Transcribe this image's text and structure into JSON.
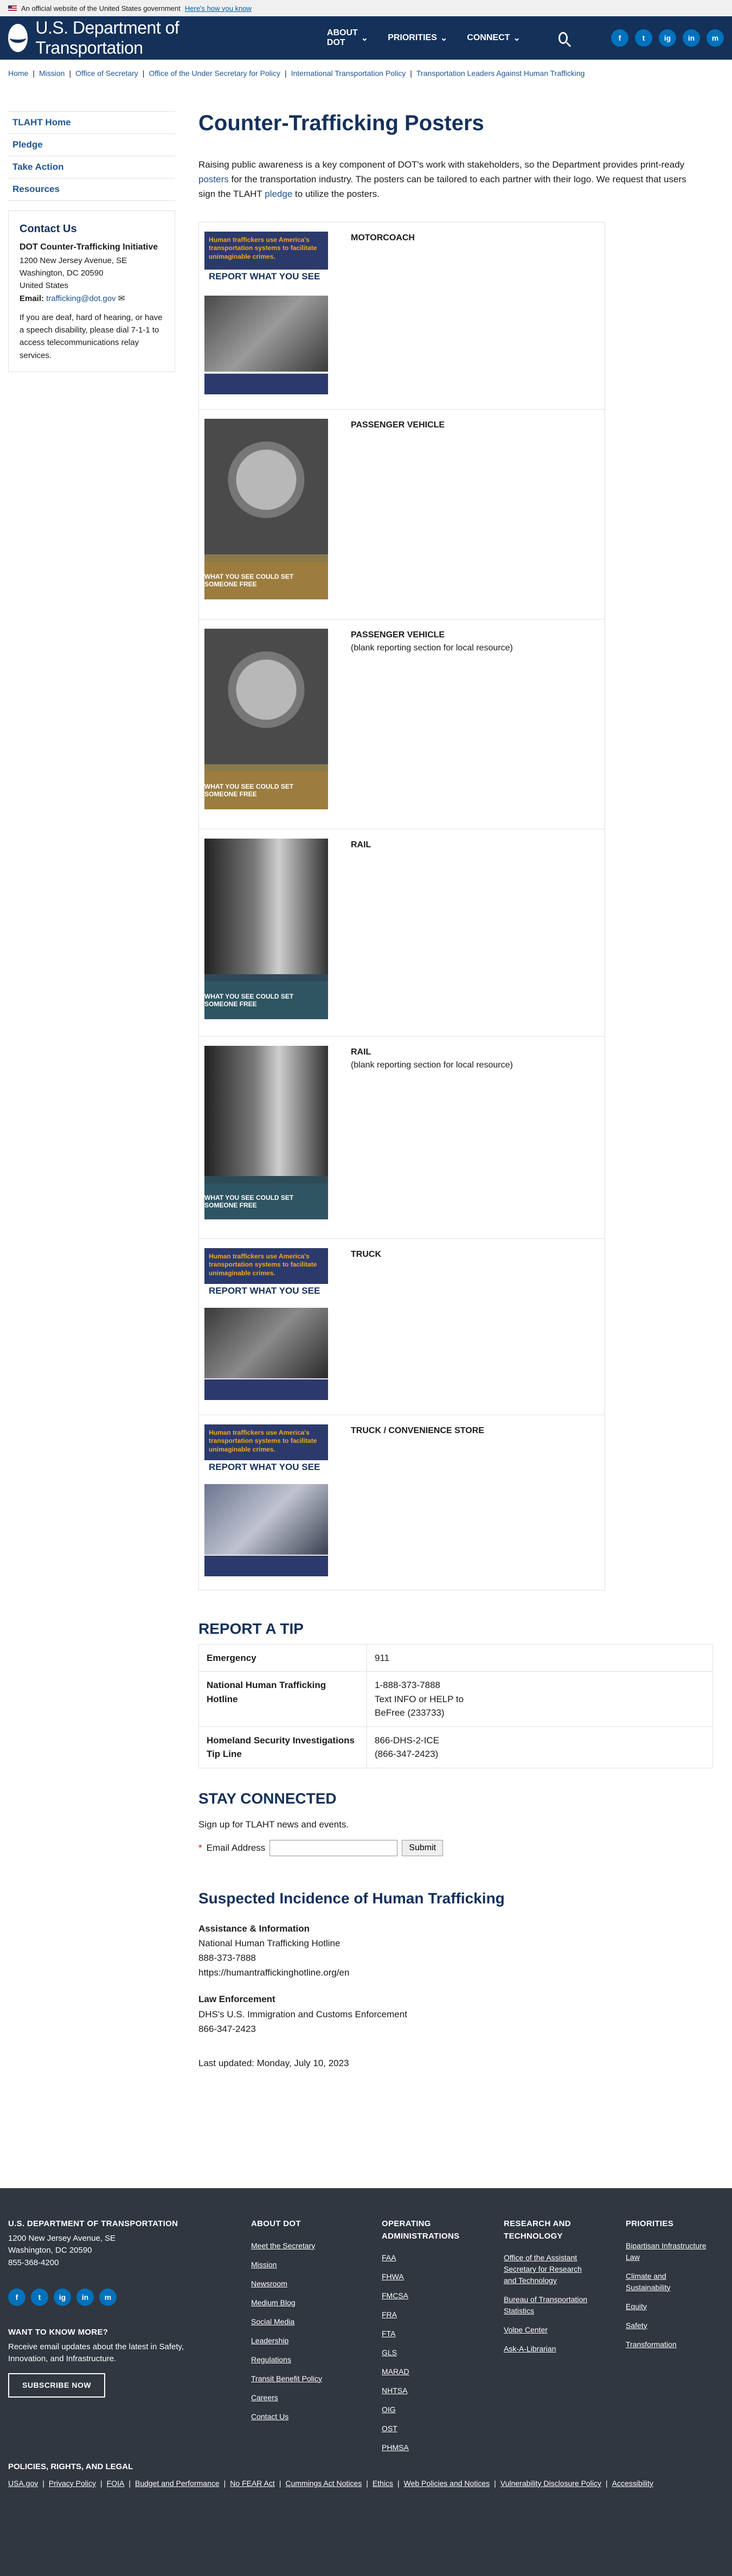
{
  "banner": {
    "text": "An official website of the United States government",
    "link": "Here's how you know"
  },
  "header": {
    "site_name": "U.S. Department of Transportation",
    "nav": [
      "ABOUT DOT",
      "PRIORITIES",
      "CONNECT"
    ],
    "social": [
      "f",
      "t",
      "ig",
      "in",
      "m"
    ]
  },
  "breadcrumb": [
    "Home",
    "Mission",
    "Office of Secretary",
    "Office of the Under Secretary for Policy",
    "International Transportation Policy",
    "Transportation Leaders Against Human Trafficking"
  ],
  "sidebar": {
    "nav": [
      "TLAHT Home",
      "Pledge",
      "Take Action",
      "Resources"
    ],
    "contact": {
      "title": "Contact Us",
      "name": "DOT Counter-Trafficking Initiative",
      "addr1": "1200 New Jersey Avenue, SE",
      "addr2": "Washington, DC 20590",
      "country": "United States",
      "email_label": "Email:",
      "email": "trafficking@dot.gov",
      "note": "If you are deaf, hard of hearing, or have a speech disability, please dial 7-1-1 to access telecommunications relay services."
    }
  },
  "main": {
    "title": "Counter-Trafficking Posters",
    "intro_1": "Raising public awareness is a key component of DOT's work with stakeholders, so the Department provides print-ready",
    "intro_link1": "posters",
    "intro_2": "for the transportation industry.  The posters can be tailored to each partner with their logo.  We request that users sign the TLAHT",
    "intro_link2": "pledge",
    "intro_3": "to utilize the posters."
  },
  "posters": [
    {
      "label": "MOTORCOACH",
      "sub": ""
    },
    {
      "label": "PASSENGER VEHICLE",
      "sub": ""
    },
    {
      "label": "PASSENGER VEHICLE",
      "sub": "(blank reporting section for local resource)"
    },
    {
      "label": "RAIL",
      "sub": ""
    },
    {
      "label": "RAIL",
      "sub": "(blank reporting section for local resource)"
    },
    {
      "label": "TRUCK",
      "sub": ""
    },
    {
      "label": "TRUCK / CONVENIENCE STORE",
      "sub": ""
    }
  ],
  "poster_text": {
    "headline": "Human traffickers use America's transportation systems to facilitate unimaginable crimes.",
    "report": "REPORT WHAT YOU SEE",
    "foot": "WHAT YOU SEE COULD SET SOMEONE FREE"
  },
  "tip": {
    "title": "REPORT A TIP",
    "rows": [
      {
        "k": "Emergency",
        "v1": "911",
        "v2": "",
        "v3": ""
      },
      {
        "k": "National Human Trafficking Hotline",
        "v1": "1-888-373-7888",
        "v2": "Text INFO or HELP to",
        "v3": "BeFree (233733)"
      },
      {
        "k": "Homeland Security Investigations Tip Line",
        "v1": "866-DHS-2-ICE",
        "v2": "(866-347-2423)",
        "v3": ""
      }
    ]
  },
  "stay": {
    "title": "STAY CONNECTED",
    "desc": "Sign up for TLAHT news and events.",
    "email_label": "Email Address",
    "submit": "Submit"
  },
  "suspected": {
    "title": "Suspected Incidence of Human Trafficking",
    "a_title": "Assistance & Information",
    "a1": "National Human Trafficking Hotline",
    "a2": "888-373-7888",
    "a3": "https://humantraffickinghotline.org/en",
    "l_title": "Law Enforcement",
    "l1": "DHS's U.S. Immigration and Customs Enforcement",
    "l2": "866-347-2423"
  },
  "last_updated": "Last updated: Monday, July 10, 2023",
  "footer": {
    "org": "U.S. DEPARTMENT OF TRANSPORTATION",
    "addr1": "1200 New Jersey Avenue, SE",
    "addr2": "Washington, DC 20590",
    "phone": "855-368-4200",
    "want": "WANT TO KNOW MORE?",
    "want_desc": "Receive email updates about the latest in Safety, Innovation, and Infrastructure.",
    "subscribe": "SUBSCRIBE NOW",
    "about_title": "ABOUT DOT",
    "about": [
      "Meet the Secretary",
      "Mission",
      "Newsroom",
      "Medium Blog",
      "Social Media",
      "Leadership",
      "Regulations",
      "Transit Benefit Policy",
      "Careers",
      "Contact Us"
    ],
    "op_title": "OPERATING ADMINISTRATIONS",
    "op": [
      "FAA",
      "FHWA",
      "FMCSA",
      "FRA",
      "FTA",
      "GLS",
      "MARAD",
      "NHTSA",
      "OIG",
      "OST",
      "PHMSA"
    ],
    "rt_title": "RESEARCH AND TECHNOLOGY",
    "rt": [
      "Office of the Assistant Secretary for Research and Technology",
      "Bureau of Transportation Statistics",
      "Volpe Center",
      "Ask-A-Librarian"
    ],
    "pr_title": "PRIORITIES",
    "pr": [
      "Bipartisan Infrastructure Law",
      "Climate and Sustainability",
      "Equity",
      "Safety",
      "Transformation"
    ],
    "legal_title": "POLICIES, RIGHTS, AND LEGAL",
    "legal": [
      "USA.gov",
      "Privacy Policy",
      "FOIA",
      "Budget and Performance",
      "No FEAR Act",
      "Cummings Act Notices",
      "Ethics",
      "Web Policies and Notices",
      "Vulnerability Disclosure Policy",
      "Accessibility"
    ]
  }
}
